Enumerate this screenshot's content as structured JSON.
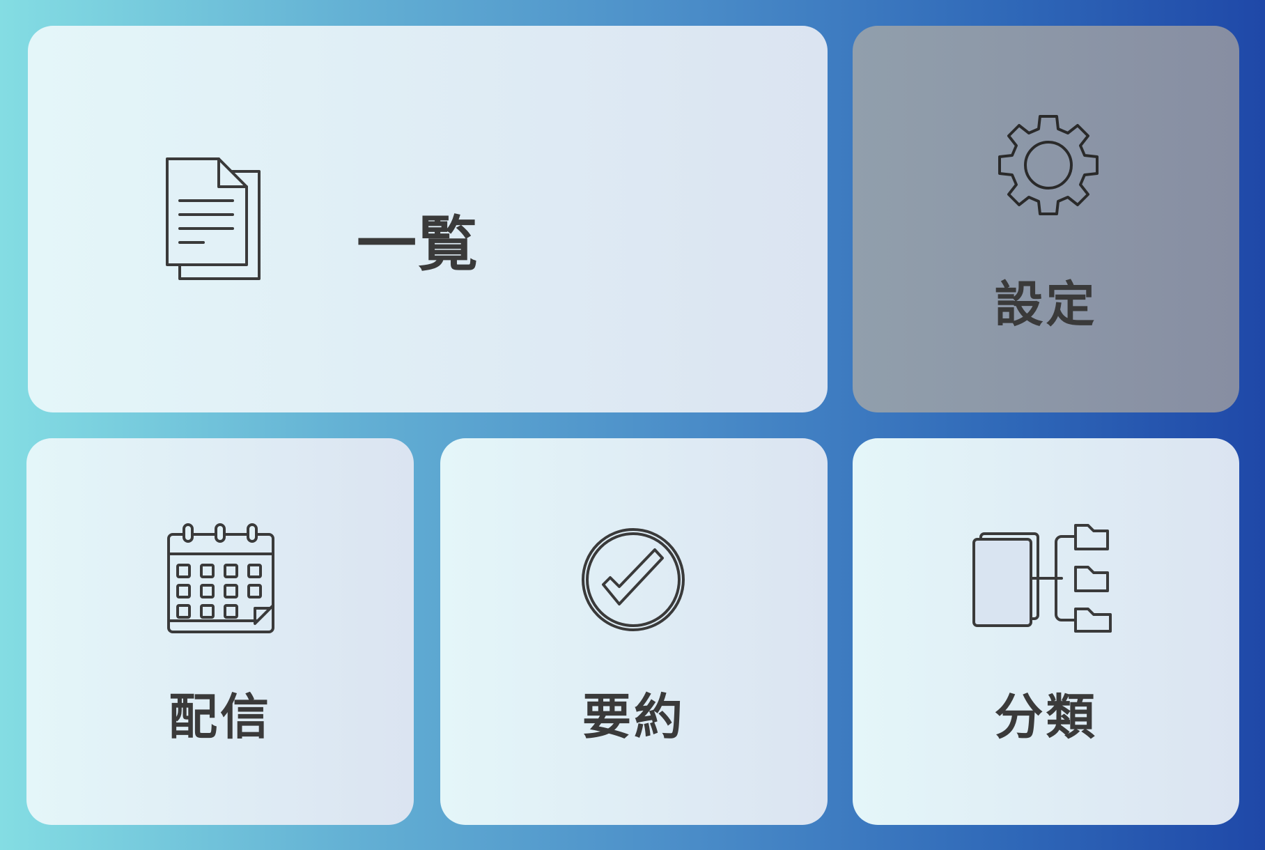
{
  "menu": {
    "list": {
      "label": "一覧",
      "icon": "documents-icon"
    },
    "settings": {
      "label": "設定",
      "icon": "gear-icon"
    },
    "distribution": {
      "label": "配信",
      "icon": "calendar-icon"
    },
    "summary": {
      "label": "要約",
      "icon": "check-circle-icon"
    },
    "classification": {
      "label": "分類",
      "icon": "folder-tree-icon"
    }
  },
  "colors": {
    "tile_light": "#e1eef6",
    "tile_dim": "#8d97a8",
    "text": "#3a3a3a",
    "icon_stroke": "#3a3a3a",
    "background_start": "#84dde3",
    "background_end": "#1f48a8"
  }
}
